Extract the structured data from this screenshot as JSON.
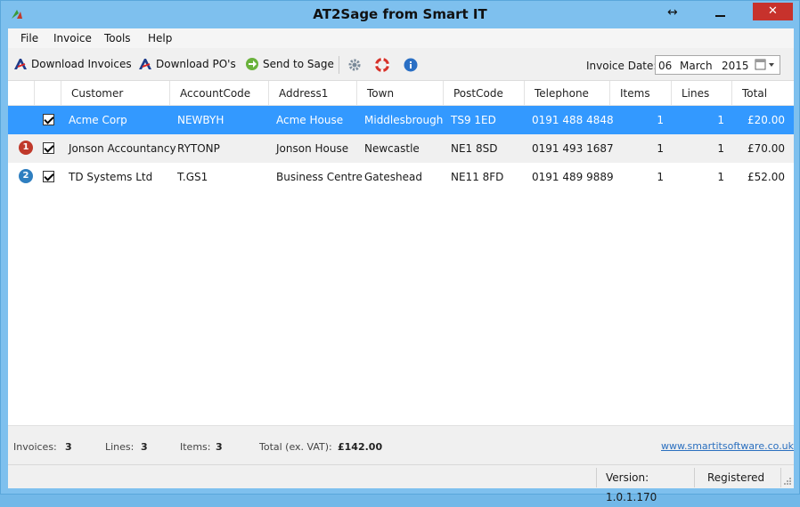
{
  "window": {
    "title": "AT2Sage from Smart IT",
    "close_label": "✕"
  },
  "menu": [
    "File",
    "Invoice",
    "Tools",
    "Help"
  ],
  "toolbar": {
    "download_invoices": "Download Invoices",
    "download_pos": "Download PO's",
    "send_to_sage": "Send to Sage",
    "invoice_date_label": "Invoice Date:",
    "date_day": "06",
    "date_month": "March",
    "date_year": "2015"
  },
  "grid": {
    "columns": [
      "Customer",
      "AccountCode",
      "Address1",
      "Town",
      "PostCode",
      "Telephone",
      "Items",
      "Lines",
      "Total"
    ],
    "rows": [
      {
        "badge": "",
        "checked": true,
        "customer": "Acme Corp",
        "account": "NEWBYH",
        "address1": "Acme House",
        "town": "Middlesbrough",
        "postcode": "TS9 1ED",
        "telephone": "0191 488 4848",
        "items": "1",
        "lines": "1",
        "total": "£20.00"
      },
      {
        "badge": "1",
        "checked": true,
        "customer": "Jonson Accountancy",
        "account": "RYTONP",
        "address1": "Jonson House",
        "town": "Newcastle",
        "postcode": "NE1 8SD",
        "telephone": "0191 493 1687",
        "items": "1",
        "lines": "1",
        "total": "£70.00"
      },
      {
        "badge": "2",
        "checked": true,
        "customer": "TD Systems Ltd",
        "account": "T.GS1",
        "address1": "Business Centre",
        "town": "Gateshead",
        "postcode": "NE11 8FD",
        "telephone": "0191 489 9889",
        "items": "1",
        "lines": "1",
        "total": "£52.00"
      }
    ]
  },
  "footer": {
    "invoices_label": "Invoices:",
    "invoices": "3",
    "lines_label": "Lines:",
    "lines": "3",
    "items_label": "Items:",
    "items": "3",
    "total_label": "Total (ex. VAT):",
    "total": "£142.00",
    "link": "www.smartitsoftware.co.uk"
  },
  "status": {
    "version": "Version:  1.0.1.170",
    "registered": "Registered"
  },
  "colors": {
    "selected_row": "#3399ff",
    "badge_red": "#c0392b",
    "badge_blue": "#2f7fc0",
    "title_bar": "#7ec0ee"
  }
}
